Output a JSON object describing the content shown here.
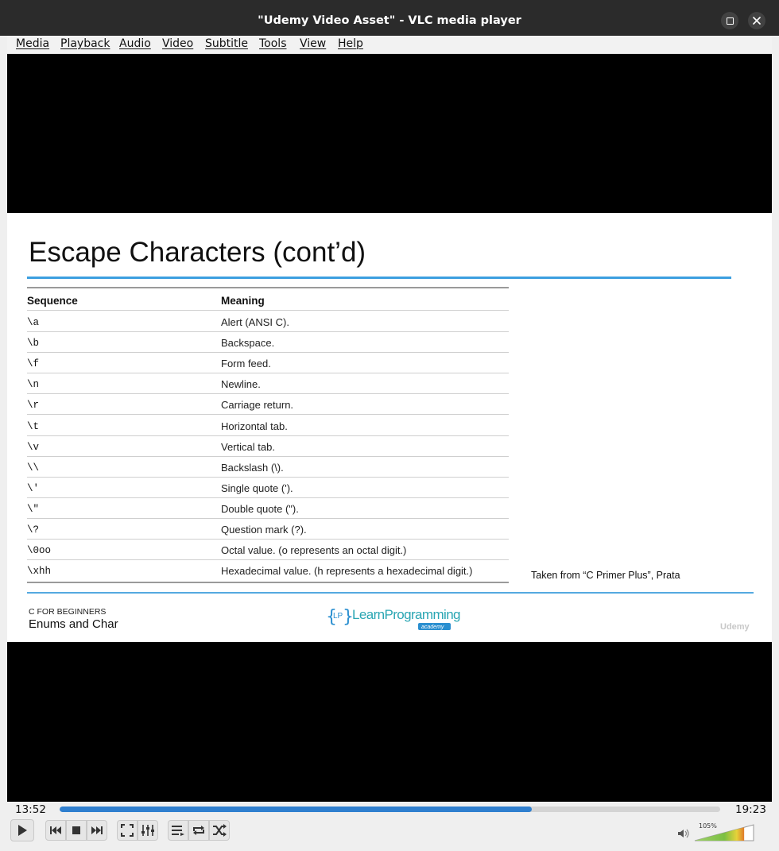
{
  "window": {
    "title": "\"Udemy Video Asset\" - VLC media player"
  },
  "menu": [
    "Media",
    "Playback",
    "Audio",
    "Video",
    "Subtitle",
    "Tools",
    "View",
    "Help"
  ],
  "slide": {
    "title": "Escape Characters (cont’d)",
    "table": {
      "headers": [
        "Sequence",
        "Meaning"
      ],
      "rows": [
        {
          "seq": "\\a",
          "meaning": "Alert (ANSI C)."
        },
        {
          "seq": "\\b",
          "meaning": "Backspace."
        },
        {
          "seq": "\\f",
          "meaning": "Form feed."
        },
        {
          "seq": "\\n",
          "meaning": "Newline."
        },
        {
          "seq": "\\r",
          "meaning": "Carriage return."
        },
        {
          "seq": "\\t",
          "meaning": "Horizontal tab."
        },
        {
          "seq": "\\v",
          "meaning": "Vertical tab."
        },
        {
          "seq": "\\\\",
          "meaning": "Backslash (\\)."
        },
        {
          "seq": "\\'",
          "meaning": "Single quote (')."
        },
        {
          "seq": "\\\"",
          "meaning": "Double quote (\")."
        },
        {
          "seq": "\\?",
          "meaning": "Question mark (?)."
        },
        {
          "seq": "\\0oo",
          "meaning": "Octal value. (o represents an octal digit.)"
        },
        {
          "seq": "\\xhh",
          "meaning": "Hexadecimal value. (h represents a hexadecimal digit.)"
        }
      ]
    },
    "credit": "Taken from “C Primer Plus”, Prata",
    "course": "C FOR BEGINNERS",
    "section": "Enums and Char",
    "logo_text": "LearnProgramming",
    "logo_sub": "academy",
    "logo_badge": "LP",
    "watermark": "Udemy"
  },
  "player": {
    "elapsed": "13:52",
    "total": "19:23",
    "progress": 0.715,
    "volume_label": "105%",
    "volume": 1.05
  },
  "colors": {
    "titlebar": "#2b2b2b",
    "seek_fill": "#2f7fcf",
    "slide_rule": "#3c9fe0",
    "logo_blue": "#2a8fd0",
    "logo_teal": "#2aa6b3"
  },
  "icons": [
    "maximize-icon",
    "close-icon",
    "play-icon",
    "previous-icon",
    "stop-icon",
    "next-icon",
    "fullscreen-icon",
    "extended-settings-icon",
    "playlist-icon",
    "loop-icon",
    "shuffle-icon",
    "volume-icon"
  ]
}
